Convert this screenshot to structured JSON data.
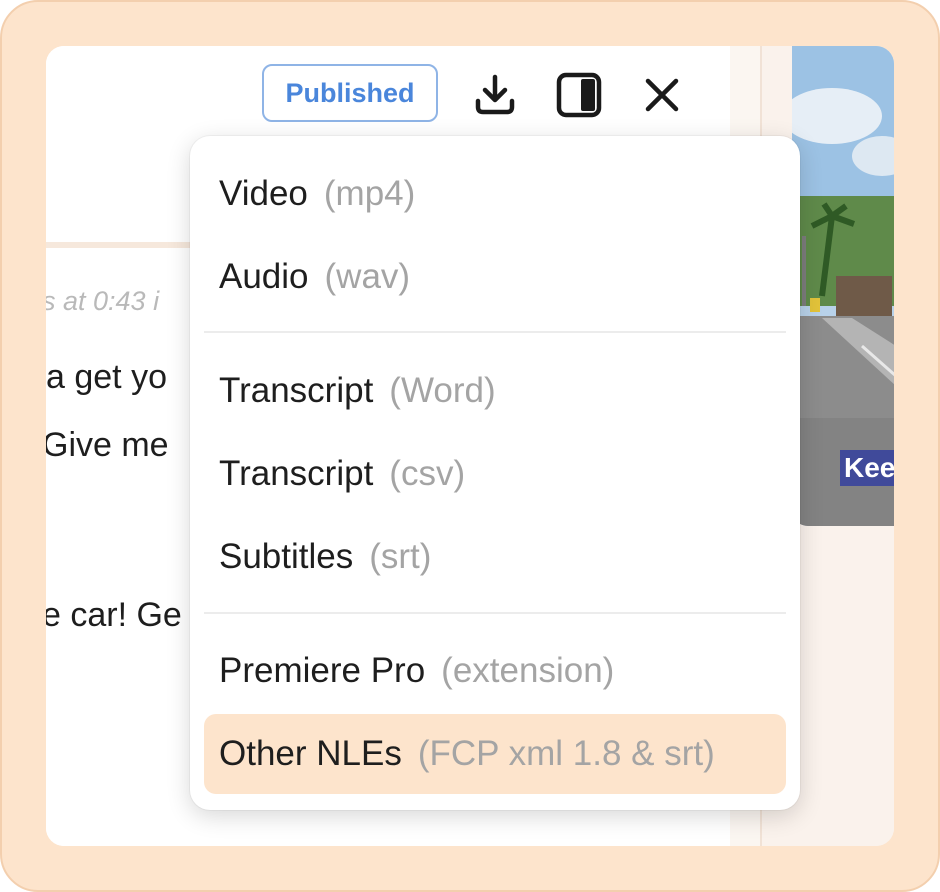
{
  "toolbar": {
    "status_badge": "Published",
    "icons": [
      "download-icon",
      "panel-toggle-icon",
      "close-icon"
    ]
  },
  "transcript": {
    "meta_line": "s at 0:43 i",
    "lines": [
      "a get yo",
      "Give me",
      "e car! Ge"
    ]
  },
  "preview": {
    "caption": "Kee"
  },
  "export_menu": {
    "items": [
      {
        "label": "Video",
        "format": "(mp4)"
      },
      {
        "label": "Audio",
        "format": "(wav)"
      },
      {
        "label": "Transcript",
        "format": "(Word)"
      },
      {
        "label": "Transcript",
        "format": "(csv)"
      },
      {
        "label": "Subtitles",
        "format": "(srt)"
      },
      {
        "label": "Premiere Pro",
        "format": "(extension)"
      },
      {
        "label": "Other NLEs",
        "format": "(FCP xml 1.8 & srt)"
      }
    ],
    "highlighted_item": "Other NLEs"
  },
  "colors": {
    "frame_bg": "#fde4cc",
    "badge_blue": "#4a86db",
    "highlight": "#fde4cc"
  }
}
